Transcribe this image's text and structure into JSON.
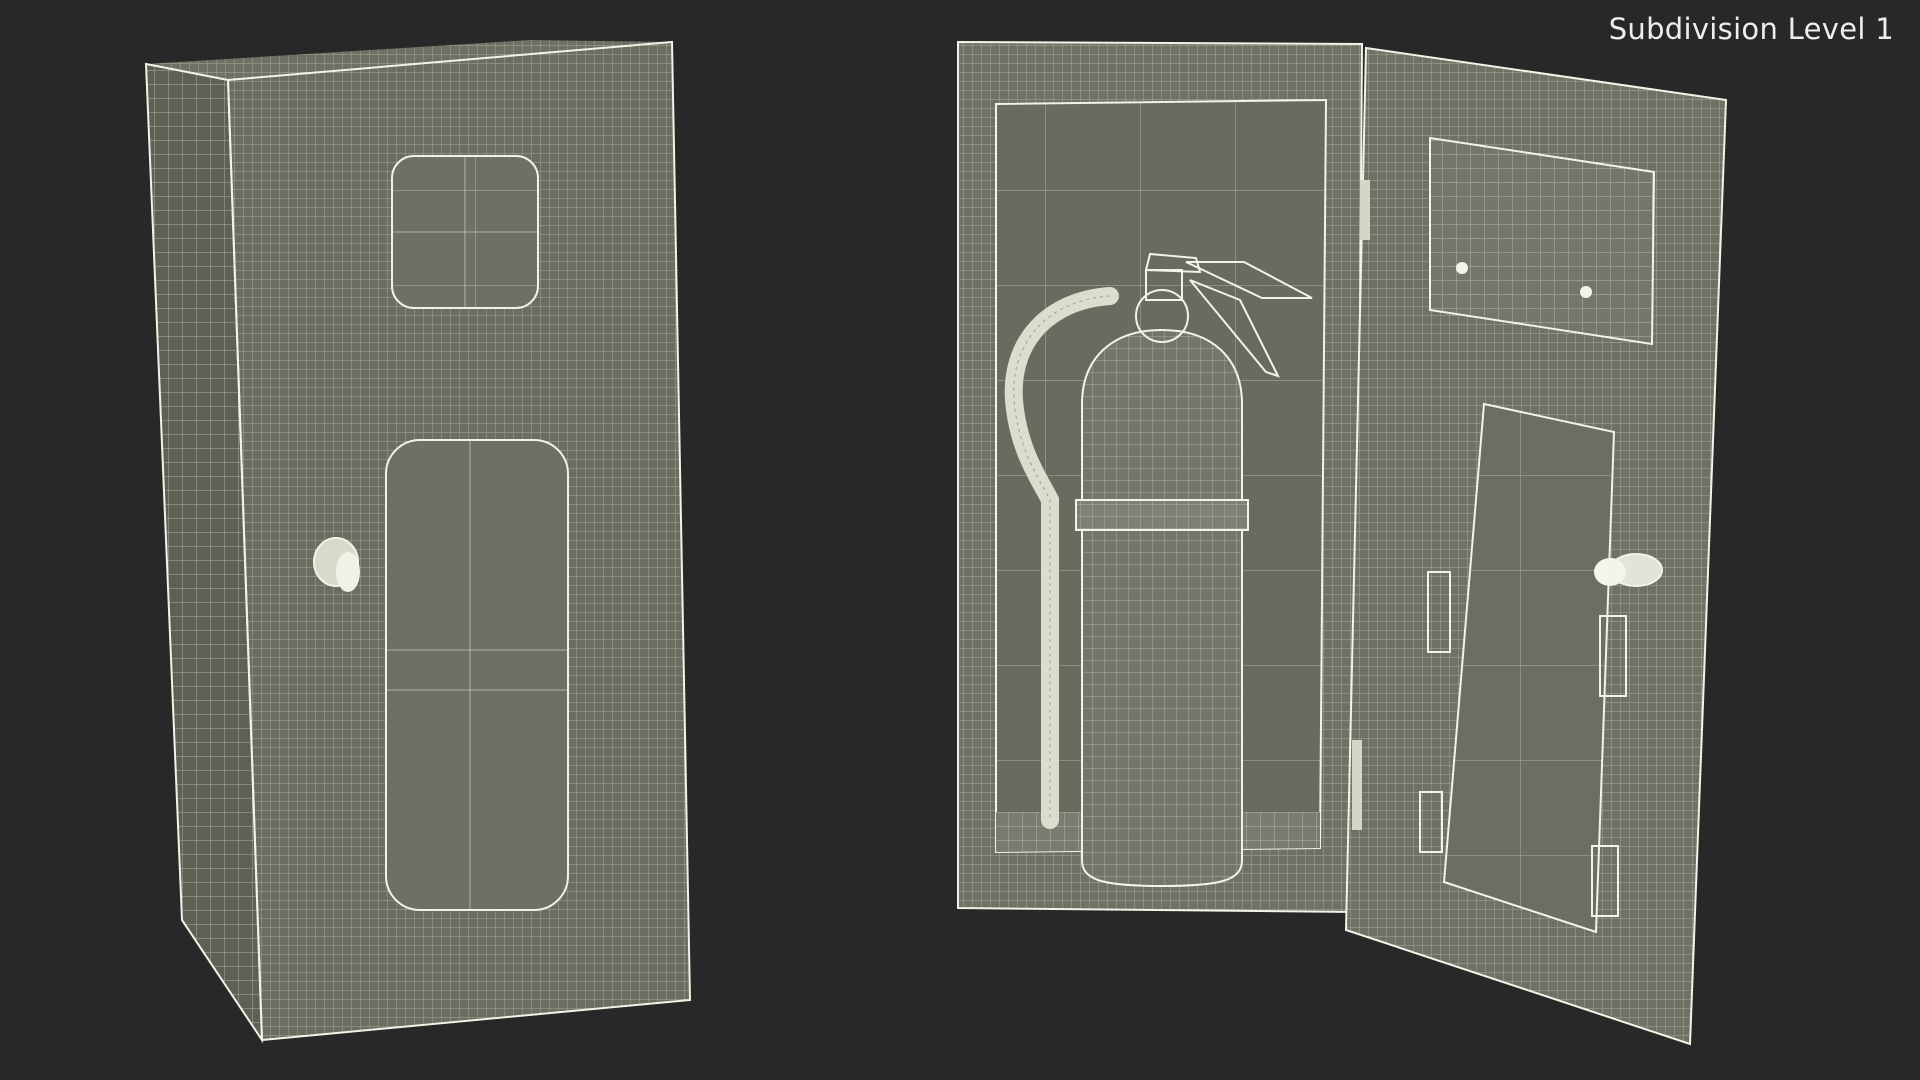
{
  "viewport": {
    "subdivision_label": "Subdivision Level 1",
    "background_color": "#282828",
    "wire_color": "#ecebdf",
    "surface_color": "#6f7064"
  },
  "objects": [
    {
      "name": "Fire Extinguisher Cabinet (closed)"
    },
    {
      "name": "Fire Extinguisher Cabinet (open)"
    }
  ]
}
